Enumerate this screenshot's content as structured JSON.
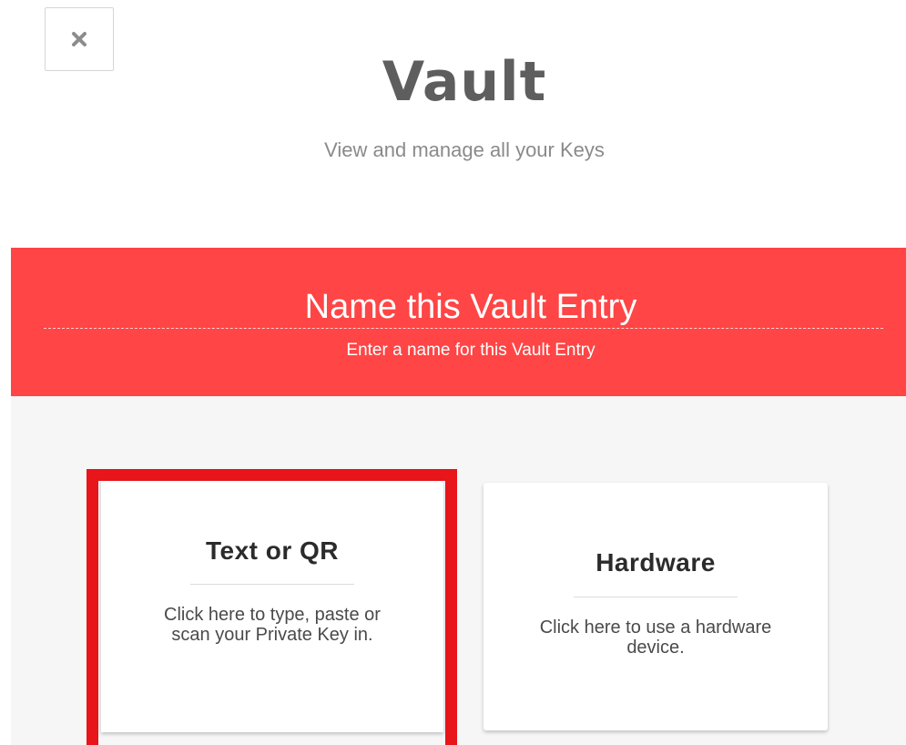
{
  "header": {
    "close_icon": "close-icon",
    "title": "Vault",
    "subtitle": "View and manage all your Keys"
  },
  "banner": {
    "title": "Name this Vault Entry",
    "subtitle": "Enter a name for this Vault Entry",
    "color": "#ff4545"
  },
  "options": [
    {
      "title": "Text or QR",
      "description": "Click here to type, paste or scan your Private Key in.",
      "selected": true
    },
    {
      "title": "Hardware",
      "description": "Click here to use a hardware device.",
      "selected": false
    }
  ],
  "colors": {
    "highlight": "#e8151b",
    "panel_background": "#f6f6f6"
  }
}
